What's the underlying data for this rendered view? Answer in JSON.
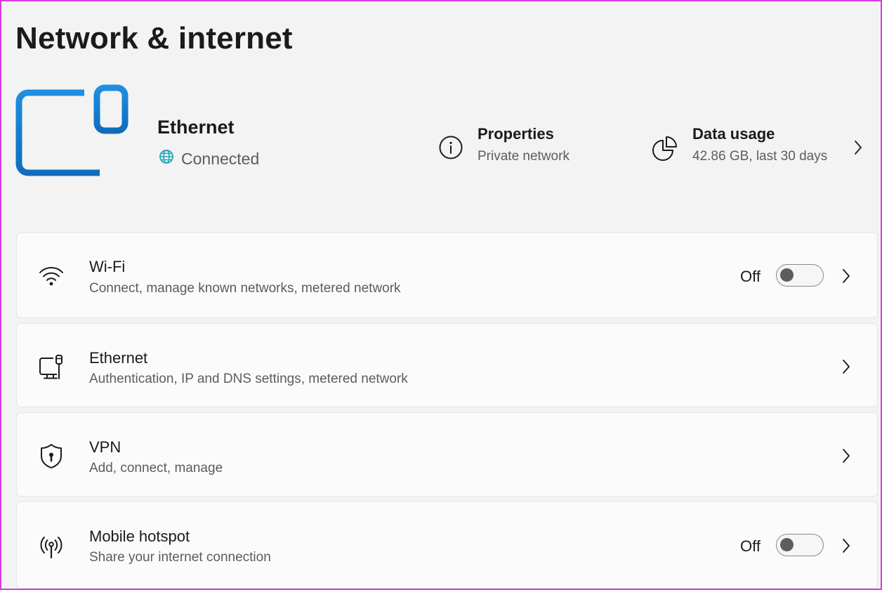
{
  "page": {
    "title": "Network & internet"
  },
  "hero": {
    "connection_name": "Ethernet",
    "status": "Connected",
    "icon": "ethernet-monitor-icon",
    "status_icon": "globe-icon",
    "accent_color": "#0f6cbd",
    "properties": {
      "title": "Properties",
      "subtitle": "Private network",
      "icon": "info-icon"
    },
    "data_usage": {
      "title": "Data usage",
      "subtitle": "42.86 GB, last 30 days",
      "icon": "pie-chart-icon"
    }
  },
  "settings": [
    {
      "id": "wifi",
      "label": "Wi-Fi",
      "description": "Connect, manage known networks, metered network",
      "icon": "wifi-icon",
      "toggle": true,
      "toggle_state": "Off",
      "toggle_on": false
    },
    {
      "id": "ethernet",
      "label": "Ethernet",
      "description": "Authentication, IP and DNS settings, metered network",
      "icon": "ethernet-icon",
      "toggle": false
    },
    {
      "id": "vpn",
      "label": "VPN",
      "description": "Add, connect, manage",
      "icon": "shield-lock-icon",
      "toggle": false
    },
    {
      "id": "mobile-hotspot",
      "label": "Mobile hotspot",
      "description": "Share your internet connection",
      "icon": "hotspot-icon",
      "toggle": true,
      "toggle_state": "Off",
      "toggle_on": false
    }
  ]
}
